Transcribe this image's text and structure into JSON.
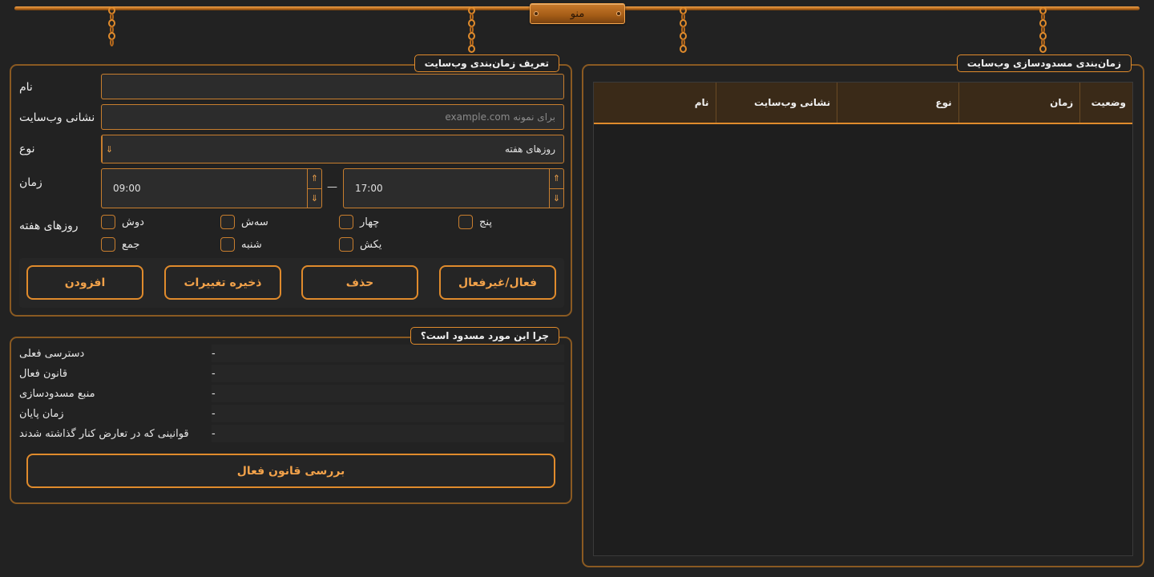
{
  "menu": {
    "label": "منو"
  },
  "definition": {
    "title": "تعریف زمان‌بندی وب‌سایت",
    "name_label": "نام",
    "name_value": "",
    "url_label": "نشانی وب‌سایت",
    "url_placeholder": "برای نمونه example.com",
    "type_label": "نوع",
    "type_value": "روزهای هفته",
    "time_label": "زمان",
    "time_start": "09:00",
    "time_end": "17:00",
    "time_separator": "—",
    "days_label": "روزهای هفته",
    "days": [
      "دوش",
      "سه‌ش",
      "چهار",
      "پنج",
      "جمع",
      "شنبه",
      "یکش"
    ],
    "buttons": {
      "add": "افزودن",
      "save": "ذخیره تغییرات",
      "delete": "حذف",
      "toggle": "فعال/غیرفعال"
    }
  },
  "why": {
    "title": "چرا این مورد مسدود است؟",
    "rows": [
      {
        "key": "دسترسی فعلی",
        "value": "-"
      },
      {
        "key": "قانون فعال",
        "value": "-"
      },
      {
        "key": "منبع مسدودسازی",
        "value": "-"
      },
      {
        "key": "زمان پایان",
        "value": "-"
      },
      {
        "key": "قوانینی که در تعارض کنار گذاشته شدند",
        "value": "-"
      }
    ],
    "check_button": "بررسی قانون فعال"
  },
  "schedule": {
    "title": "زمان‌بندی مسدودسازی وب‌سایت",
    "columns": [
      "وضعیت",
      "زمان",
      "نوع",
      "نشانی وب‌سایت",
      "نام"
    ]
  }
}
